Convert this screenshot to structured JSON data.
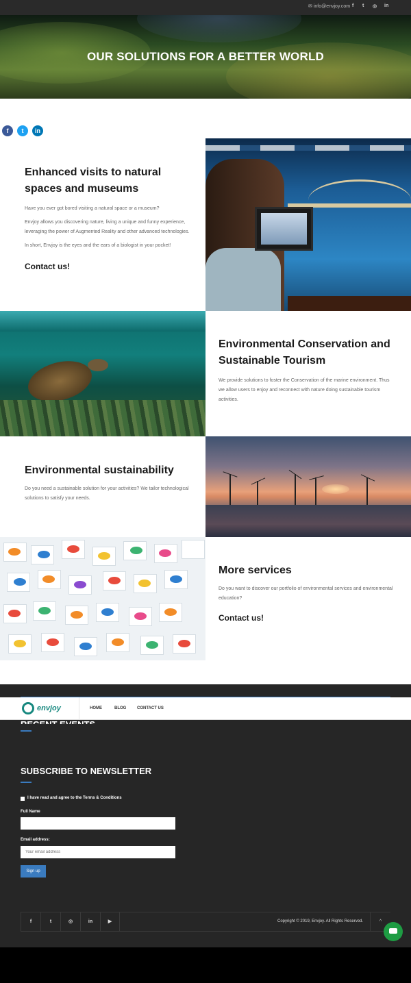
{
  "topbar": {
    "email": "info@envjoy.com",
    "social_icons": [
      "facebook-icon",
      "twitter-icon",
      "instagram-icon",
      "linkedin-icon"
    ],
    "icon_glyphs": [
      "f",
      "t",
      "◎",
      "in"
    ]
  },
  "hero": {
    "title": "OUR SOLUTIONS FOR A BETTER WORLD"
  },
  "share": {
    "facebook": "f",
    "twitter": "t",
    "linkedin": "in"
  },
  "sections": [
    {
      "title": "Enhanced visits to natural spaces and museums",
      "paragraphs": [
        "Have you ever got bored visiting a natural space or a museum?",
        "Envjoy allows you discovering nature, living a unique and funny experience, leveraging the power of Augmented Reality and other advanced technologies.",
        "In short, Envjoy is the eyes and the ears of a biologist in your pocket!"
      ],
      "cta": "Contact us!"
    },
    {
      "title": "Environmental Conservation and Sustainable Tourism",
      "paragraphs": [
        "We provide solutions to foster the Conservation of the marine environment. Thus we allow users to enjoy and reconnect with nature doing sustainable tourism activities."
      ]
    },
    {
      "title": "Environmental sustainability",
      "paragraphs": [
        "Do you need a sustainable solution for your activities? We tailor technological solutions to satisfy your needs."
      ]
    },
    {
      "title": "More services",
      "paragraphs": [
        "Do you want to discover our portfolio of environmental services and environmental education?"
      ],
      "cta": "Contact us!"
    }
  ],
  "navbar": {
    "logo_text": "envjoy",
    "items": [
      "HOME",
      "BLOG",
      "CONTACT US"
    ]
  },
  "footer": {
    "recent_events_title": "RECENT EVENTS",
    "newsletter_title": "SUBSCRIBE TO NEWSLETTER",
    "terms_label": "I have read and agree to the Terms & Conditions",
    "full_name_label": "Full Name",
    "full_name_value": "",
    "email_label": "Email address:",
    "email_placeholder": "Your email address",
    "signup_label": "Sign up",
    "social": [
      "f",
      "t",
      "◎",
      "in",
      "▶"
    ],
    "copyright": "Copyright © 2019, Envjoy. All Rights Reserved.",
    "to_top": "^"
  },
  "colors": {
    "accent": "#3a7bbf",
    "brand": "#17887f",
    "footer_bg": "#262626",
    "chat": "#1e9c43"
  }
}
